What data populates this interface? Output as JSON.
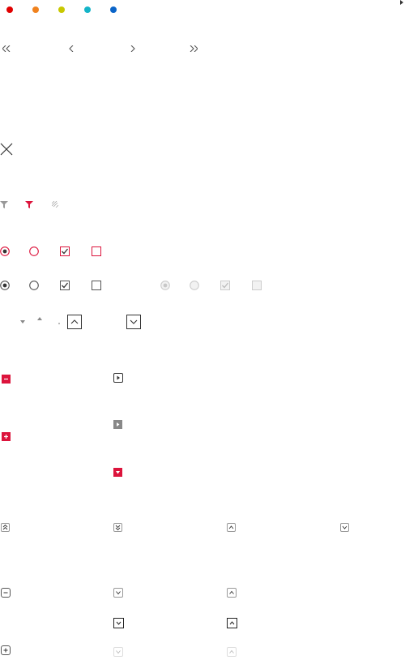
{
  "colors": {
    "status_dots": [
      "#e10000",
      "#f0821e",
      "#c8c800",
      "#14b4c8",
      "#0a64c8"
    ],
    "accent": "#dc143c",
    "gray": "#888888",
    "dark": "#333333",
    "light": "#cccccc"
  },
  "pager_icons": [
    "double-chevron-left-icon",
    "chevron-left-icon",
    "chevron-right-icon",
    "double-chevron-right-icon"
  ],
  "row_icons": {
    "close": "close-icon",
    "filters": [
      "filter-icon",
      "filter-active-icon",
      "filter-clear-icon"
    ],
    "radio_check_active": [
      "radio-checked-icon",
      "radio-unchecked-icon",
      "checkbox-checked-icon",
      "checkbox-unchecked-icon"
    ],
    "radio_check_normal": [
      "radio-checked-icon",
      "radio-unchecked-icon",
      "checkbox-checked-icon",
      "checkbox-unchecked-icon"
    ],
    "radio_check_disabled": [
      "radio-checked-icon",
      "radio-unchecked-icon",
      "checkbox-checked-icon",
      "checkbox-unchecked-icon"
    ],
    "sort_arrows": [
      "sort-down-icon",
      "sort-up-icon",
      "sort-none-icon",
      "arrow-up-box-icon",
      "arrow-down-box-icon"
    ],
    "tree": [
      "collapse-minus-icon",
      "play-box-icon",
      "expand-right-icon",
      "expand-plus-icon",
      "expand-down-icon"
    ],
    "scroll": [
      "double-up-icon",
      "double-down-icon",
      "chevron-up-icon",
      "chevron-down-icon"
    ],
    "spinners": [
      "minus-box-icon",
      "plus-box-icon",
      "spinner-down-icon",
      "spinner-up-icon"
    ]
  }
}
